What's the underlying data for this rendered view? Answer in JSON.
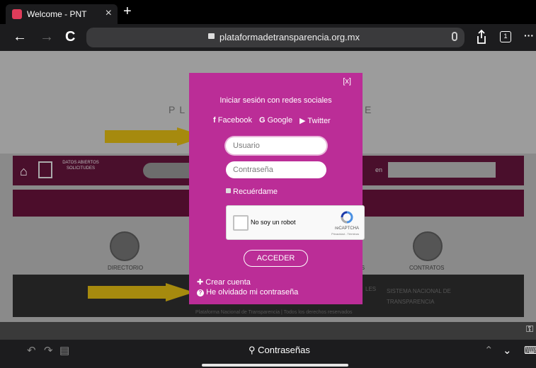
{
  "browser": {
    "tab_title": "Welcome - PNT",
    "tab_close": "×",
    "new_tab": "+",
    "url": "plataformadetransparencia.org.mx",
    "back": "←",
    "forward": "→",
    "reload": "C",
    "tab_count": "1",
    "more": "···"
  },
  "page": {
    "hero_left": "PL",
    "hero_right": "E",
    "nav_options": "DATOS ABIERTOS SOLICITUDES",
    "search_in": "en",
    "icon_labels": [
      "DIRECTORIO",
      "LES",
      "CONTRATOS"
    ],
    "footer_rights": "Plataforma Nacional de Transparencia | Todos los derechos reservados",
    "footer_sistema": "SISTEMA NACIONAL DE TRANSPARENCIA"
  },
  "login_modal": {
    "close": "[x]",
    "heading": "Iniciar sesión con redes sociales",
    "facebook": "Facebook",
    "google": "Google",
    "twitter": "Twitter",
    "username_placeholder": "Usuario",
    "password_placeholder": "Contraseña",
    "remember": "Recuérdame",
    "recaptcha_label": "No soy un robot",
    "recaptcha_brand": "reCAPTCHA",
    "recaptcha_links": "Privacidad - Términos",
    "submit": "ACCEDER",
    "create_account": "Crear cuenta",
    "forgot_password": "He olvidado mi contraseña"
  },
  "bottom_bar": {
    "passwords": "Contraseñas"
  },
  "colors": {
    "modal": "#bb2d97",
    "arrow": "#a68a0e"
  }
}
